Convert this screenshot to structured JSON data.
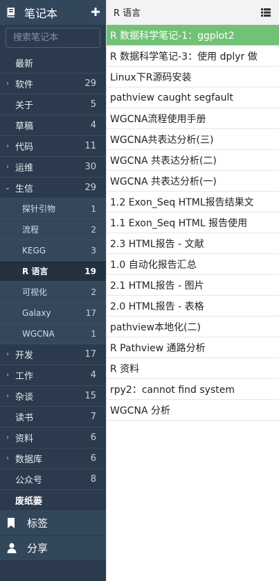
{
  "sidebar": {
    "title": "笔记本",
    "add_icon": "plus-icon",
    "search_placeholder": "搜索笔记本",
    "items": [
      {
        "label": "最新",
        "count": "",
        "chevron": "",
        "kind": "top"
      },
      {
        "label": "软件",
        "count": "29",
        "chevron": "›",
        "kind": "top"
      },
      {
        "label": "关于",
        "count": "5",
        "chevron": "",
        "kind": "top"
      },
      {
        "label": "草稿",
        "count": "4",
        "chevron": "",
        "kind": "top"
      },
      {
        "label": "代码",
        "count": "11",
        "chevron": "›",
        "kind": "top"
      },
      {
        "label": "运维",
        "count": "30",
        "chevron": "›",
        "kind": "top"
      },
      {
        "label": "生信",
        "count": "29",
        "chevron": "⌄",
        "kind": "top"
      },
      {
        "label": "探针引物",
        "count": "1",
        "kind": "sub"
      },
      {
        "label": "流程",
        "count": "2",
        "kind": "sub"
      },
      {
        "label": "KEGG",
        "count": "3",
        "kind": "sub"
      },
      {
        "label": "R 语言",
        "count": "19",
        "kind": "sub",
        "active": true
      },
      {
        "label": "可视化",
        "count": "2",
        "kind": "sub"
      },
      {
        "label": "Galaxy",
        "count": "17",
        "kind": "sub"
      },
      {
        "label": "WGCNA",
        "count": "1",
        "kind": "sub"
      },
      {
        "label": "开发",
        "count": "17",
        "chevron": "›",
        "kind": "top"
      },
      {
        "label": "工作",
        "count": "4",
        "chevron": "›",
        "kind": "top"
      },
      {
        "label": "杂谈",
        "count": "15",
        "chevron": "›",
        "kind": "top"
      },
      {
        "label": "读书",
        "count": "7",
        "chevron": "",
        "kind": "top"
      },
      {
        "label": "资料",
        "count": "6",
        "chevron": "›",
        "kind": "top"
      },
      {
        "label": "数据库",
        "count": "6",
        "chevron": "›",
        "kind": "top"
      },
      {
        "label": "公众号",
        "count": "8",
        "chevron": "",
        "kind": "top"
      },
      {
        "label": "废纸篓",
        "count": "",
        "chevron": "",
        "kind": "top",
        "bold": true
      }
    ],
    "tags_label": "标签",
    "share_label": "分享"
  },
  "list": {
    "title": "R 语言",
    "view_icon": "list-view-icon",
    "notes": [
      "R 数据科学笔记-1：ggplot2",
      "R 数据科学笔记-3：使用 dplyr 做",
      "Linux下R源码安装",
      "pathview caught segfault",
      "WGCNA流程使用手册",
      "WGCNA共表达分析(三)",
      "WGCNA 共表达分析(二)",
      "WGCNA 共表达分析(一)",
      "1.2 Exon_Seq HTML报告结果文",
      "1.1 Exon_Seq HTML 报告使用",
      "2.3 HTML报告 - 文献",
      "1.0 自动化报告汇总",
      "2.1 HTML报告 - 图片",
      "2.0 HTML报告 - 表格",
      "pathview本地化(二)",
      "R Pathview 通路分析",
      "R 资料",
      "rpy2：cannot find system",
      "WGCNA 分析"
    ],
    "active_index": 0
  },
  "colors": {
    "sidebar_bg": "#2b3a4c",
    "active_note": "#71c275"
  }
}
